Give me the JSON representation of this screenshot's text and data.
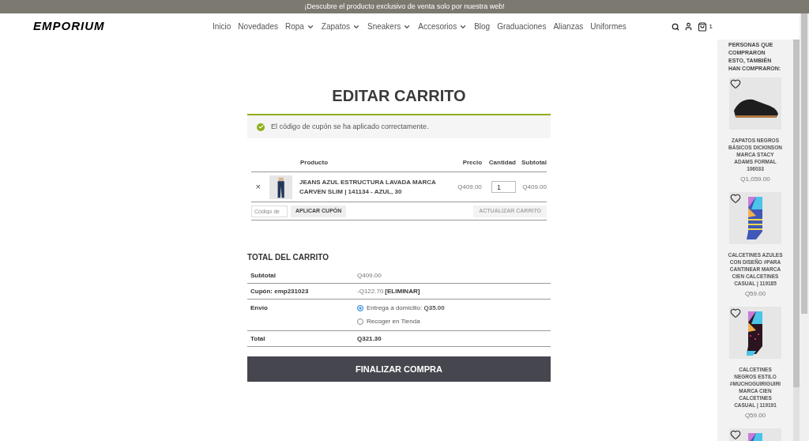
{
  "banner": "¡Descubre el producto exclusivo de venta solo por nuestra web!",
  "logo": "EMPORIUM",
  "nav": [
    {
      "label": "Inicio",
      "has_menu": false
    },
    {
      "label": "Novedades",
      "has_menu": false
    },
    {
      "label": "Ropa",
      "has_menu": true
    },
    {
      "label": "Zapatos",
      "has_menu": true
    },
    {
      "label": "Sneakers",
      "has_menu": true
    },
    {
      "label": "Accesorios",
      "has_menu": true
    },
    {
      "label": "Blog",
      "has_menu": false
    },
    {
      "label": "Graduaciones",
      "has_menu": false
    },
    {
      "label": "Alianzas",
      "has_menu": false
    },
    {
      "label": "Uniformes",
      "has_menu": false
    }
  ],
  "cart_count": "1",
  "title": "EDITAR CARRITO",
  "notice": "El código de cupón se ha aplicado correctamente.",
  "cart_table": {
    "columns": [
      "Producto",
      "Precio",
      "Cantidad",
      "Subtotal"
    ],
    "rows": [
      {
        "remove": "×",
        "product": "JEANS AZUL ESTRUCTURA LAVADA MARCA CARVEN SLIM | 141134 - AZUL, 30",
        "price": "Q409.00",
        "quantity": "1",
        "subtotal": "Q409.00"
      }
    ]
  },
  "coupon": {
    "placeholder": "Código de",
    "apply": "APLICAR CUPÓN",
    "update": "ACTUALIZAR CARRITO",
    "update_disabled": true
  },
  "totals": {
    "title": "TOTAL DEL CARRITO",
    "subtotal_label": "Subtotal",
    "subtotal": "Q409.00",
    "coupon_label": "Cupón: emp231023",
    "coupon_value": "-Q122.70",
    "coupon_remove": "[ELIMINAR]",
    "shipping_label": "Envío",
    "shipping_options": [
      {
        "label": "Entrega a domicilio: **Q35.00**",
        "selected": true
      },
      {
        "label": "Recoger en Tienda",
        "selected": false
      }
    ],
    "total_label": "Total",
    "total": "Q321.30"
  },
  "checkout": "FINALIZAR COMPRA",
  "related": {
    "title": "PERSONAS QUE COMPRARON ESTO, TAMBIÉN HAN COMPRARON:",
    "products": [
      {
        "kind": "shoe",
        "name": "ZAPATOS NEGROS BÁSICOS DICKINSON MARCA STACY ADAMS FORMAL 106033",
        "price": "Q1,059.00"
      },
      {
        "kind": "blue-sock",
        "name": "CALCETINES AZULES CON DISEÑO #PARA CANTINEAR MARCA CIEN CALCETINES CASUAL | 119185",
        "price": "Q59.00"
      },
      {
        "kind": "black-sock",
        "name": "CALCETINES NEGROS ESTILO #MUCHOGUIRIGUIRI MARCA CIEN CALCETINES CASUAL | 119191",
        "price": "Q59.00"
      },
      {
        "kind": "color-sock"
      }
    ]
  }
}
